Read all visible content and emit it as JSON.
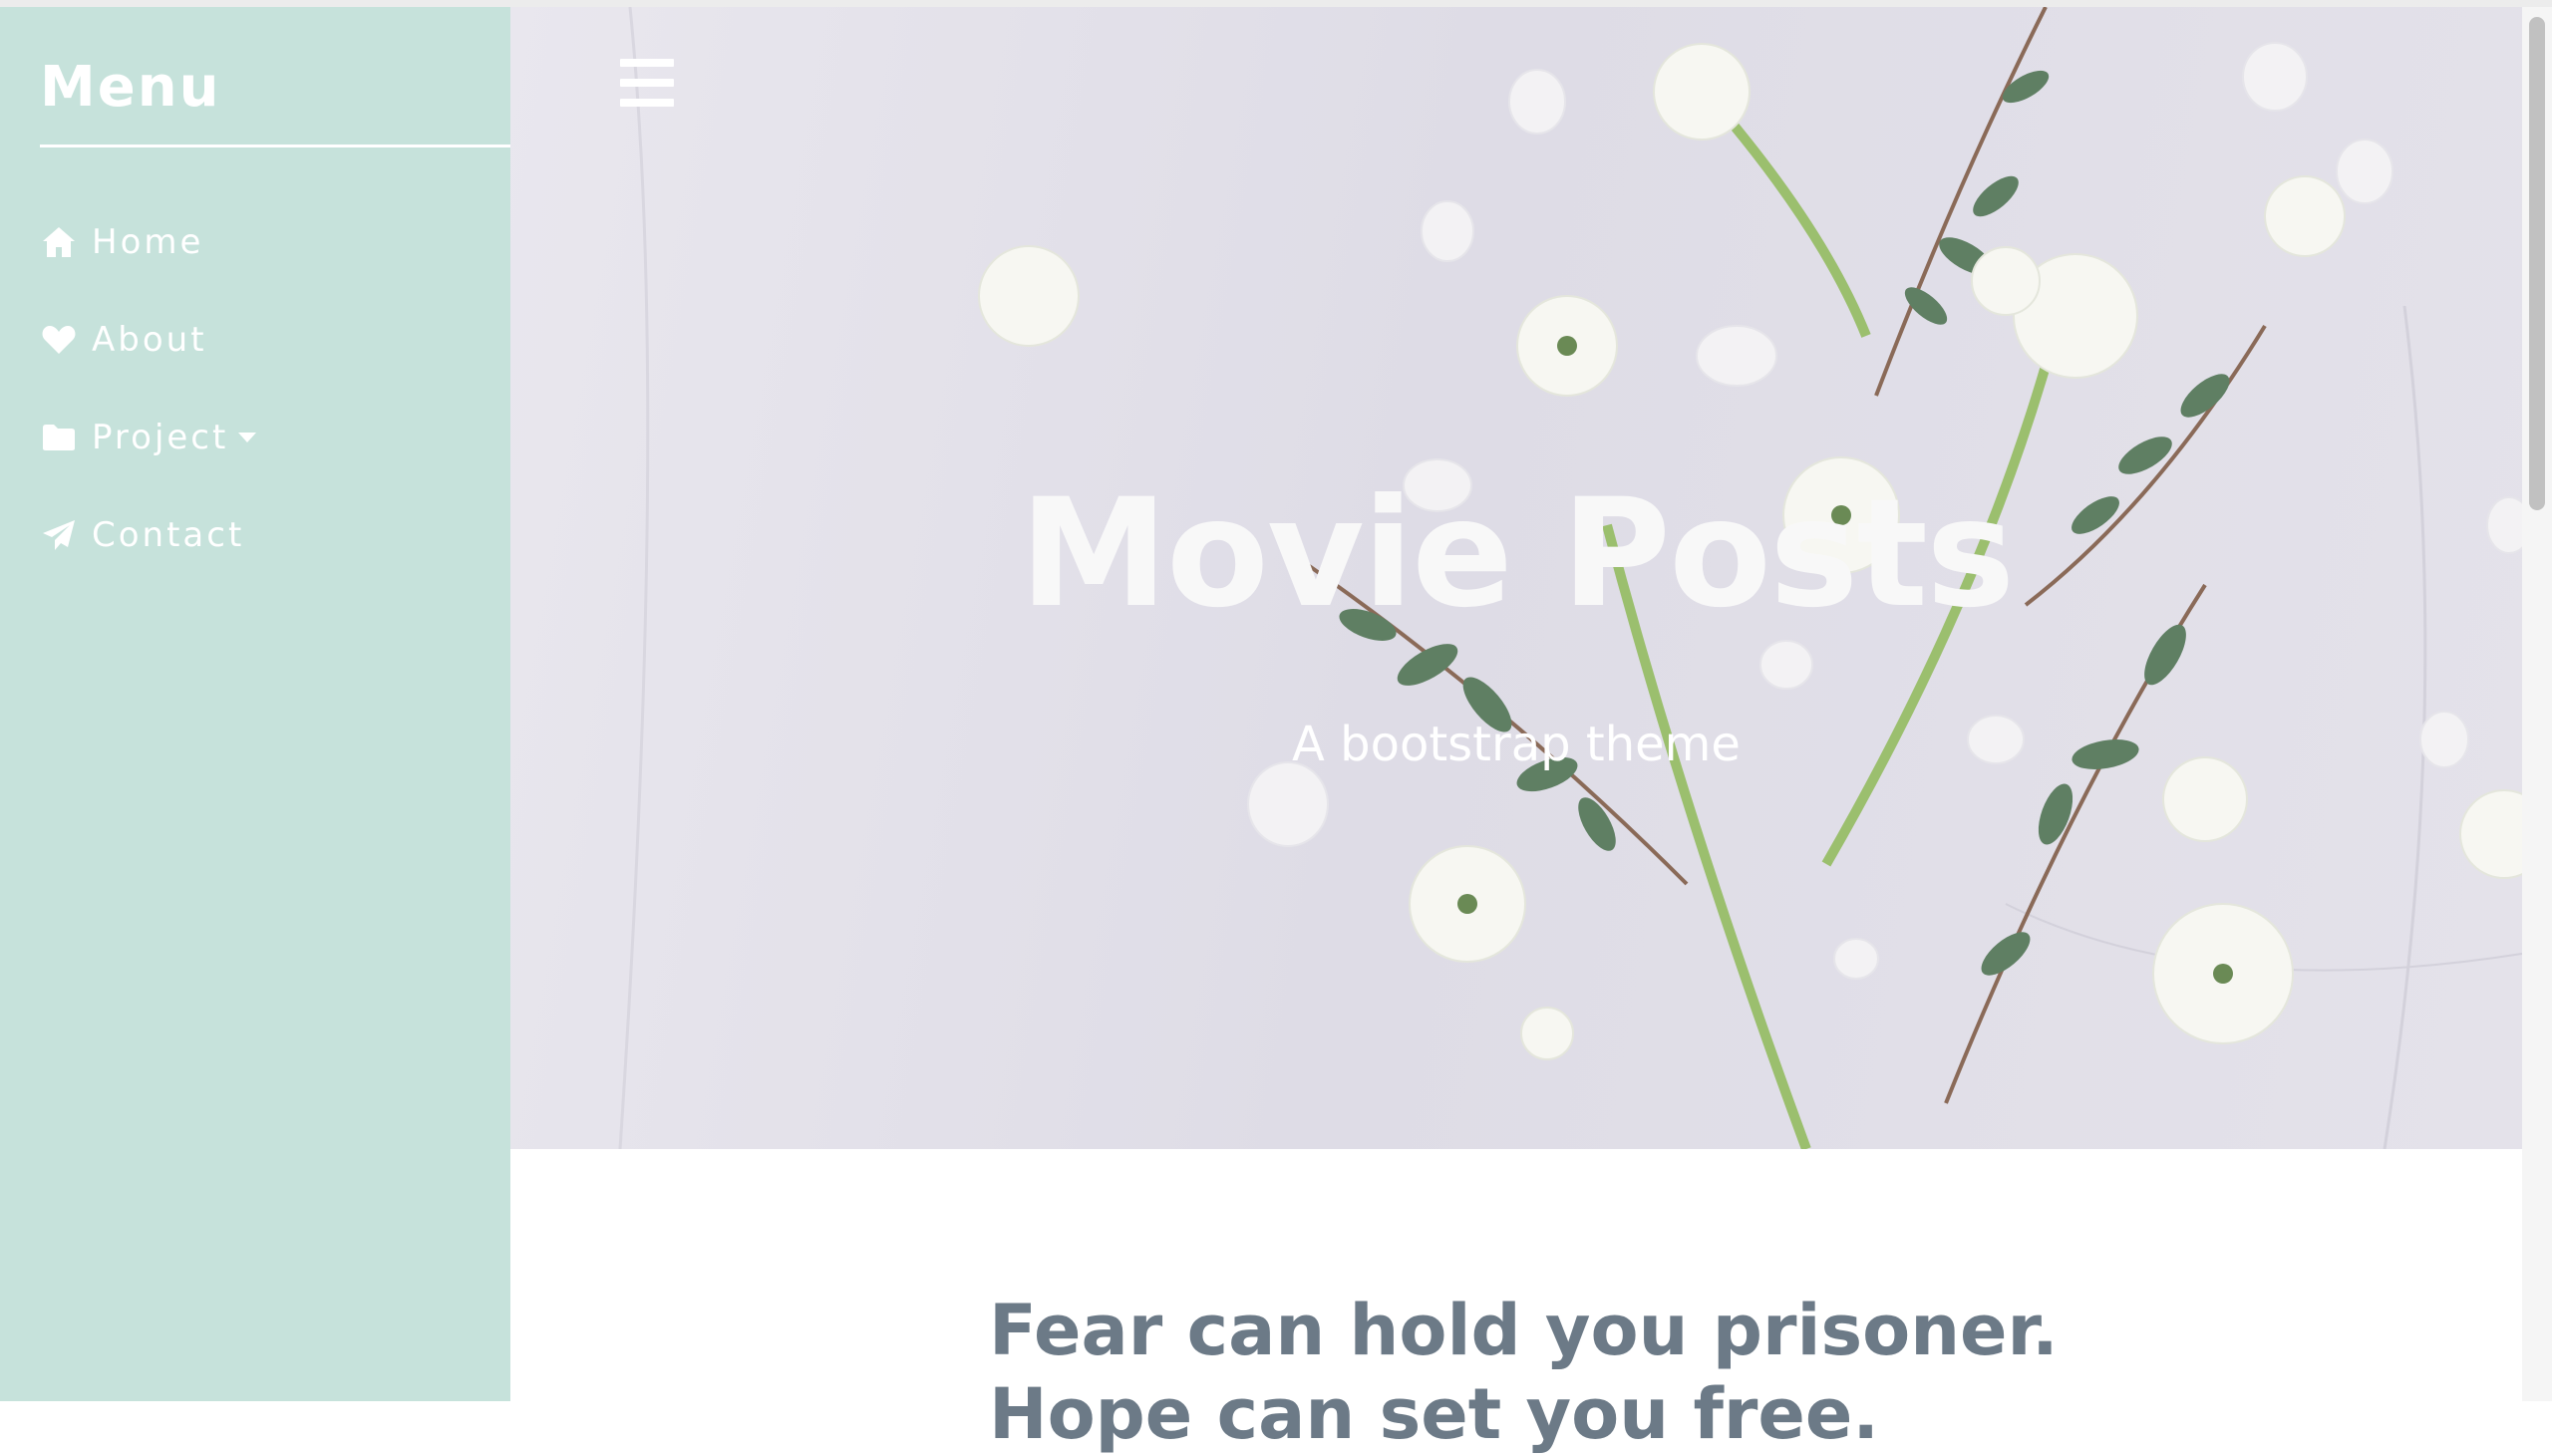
{
  "sidebar": {
    "title": "Menu",
    "items": [
      {
        "label": "Home",
        "icon": "home-icon"
      },
      {
        "label": "About",
        "icon": "heart-icon"
      },
      {
        "label": "Project",
        "icon": "folder-icon",
        "has_dropdown": true
      },
      {
        "label": "Contact",
        "icon": "paper-plane-icon"
      }
    ]
  },
  "hero": {
    "title": "Movie Posts",
    "subtitle": "A bootstrap theme",
    "menu_icon": "hamburger-menu-icon"
  },
  "main": {
    "heading_line1": "Fear can hold you prisoner.",
    "heading_line2": "Hope can set you free."
  },
  "colors": {
    "sidebar_bg": "#c6e2db",
    "heading_text": "#6c7a87",
    "hero_bg": "#e6e4ec"
  }
}
